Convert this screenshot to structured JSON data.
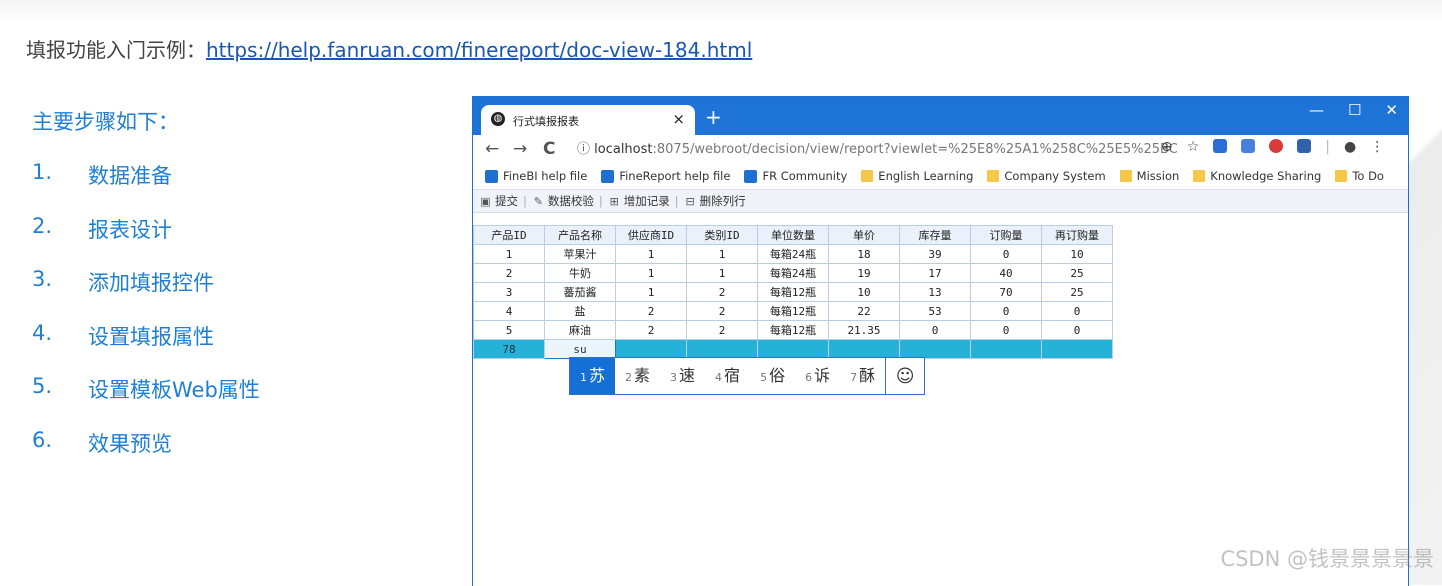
{
  "slide": {
    "intro_label": "填报功能入门示例：",
    "intro_link": "https://help.fanruan.com/finereport/doc-view-184.html",
    "steps_title": "主要步骤如下：",
    "steps": [
      {
        "num": "1.",
        "text": "数据准备"
      },
      {
        "num": "2.",
        "text": "报表设计"
      },
      {
        "num": "3.",
        "text": "添加填报控件"
      },
      {
        "num": "4.",
        "text": "设置填报属性"
      },
      {
        "num": "5.",
        "text": "设置模板Web属性"
      },
      {
        "num": "6.",
        "text": "效果预览"
      }
    ],
    "watermark": "CSDN @钱景景景景景"
  },
  "browser": {
    "tab_title": "行式填报报表",
    "tab_close": "×",
    "new_tab": "+",
    "window_buttons": {
      "minimize": "—",
      "maximize": "☐",
      "close": "✕"
    },
    "nav": {
      "back": "←",
      "forward": "→",
      "reload": "C"
    },
    "address": {
      "host": "localhost",
      "rest": ":8075/webroot/decision/view/report?viewlet=%25E8%25A1%258C%25E5%25BC..."
    },
    "bookmarks": [
      {
        "label": "FineBI help file",
        "icon": "finebi-icon"
      },
      {
        "label": "FineReport help file",
        "icon": "finereport-icon"
      },
      {
        "label": "FR Community",
        "icon": "finereport-icon"
      },
      {
        "label": "English Learning",
        "icon": "folder-icon"
      },
      {
        "label": "Company System",
        "icon": "folder-icon"
      },
      {
        "label": "Mission",
        "icon": "folder-icon"
      },
      {
        "label": "Knowledge Sharing",
        "icon": "folder-icon"
      },
      {
        "label": "To Do",
        "icon": "folder-icon"
      }
    ]
  },
  "report": {
    "toolbar": [
      {
        "label": "提交",
        "icon": "save-icon"
      },
      {
        "label": "数据校验",
        "icon": "verify-icon"
      },
      {
        "label": "增加记录",
        "icon": "add-row-icon"
      },
      {
        "label": "删除列行",
        "icon": "delete-row-icon"
      }
    ],
    "columns": [
      "产品ID",
      "产品名称",
      "供应商ID",
      "类别ID",
      "单位数量",
      "单价",
      "库存量",
      "订购量",
      "再订购量"
    ],
    "rows": [
      [
        "1",
        "苹果汁",
        "1",
        "1",
        "每箱24瓶",
        "18",
        "39",
        "0",
        "10"
      ],
      [
        "2",
        "牛奶",
        "1",
        "1",
        "每箱24瓶",
        "19",
        "17",
        "40",
        "25"
      ],
      [
        "3",
        "蕃茄酱",
        "1",
        "2",
        "每箱12瓶",
        "10",
        "13",
        "70",
        "25"
      ],
      [
        "4",
        "盐",
        "2",
        "2",
        "每箱12瓶",
        "22",
        "53",
        "0",
        "0"
      ],
      [
        "5",
        "麻油",
        "2",
        "2",
        "每箱12瓶",
        "21.35",
        "0",
        "0",
        "0"
      ]
    ],
    "new_row": [
      "78",
      "su",
      "",
      "",
      "",
      "",
      "",
      "",
      ""
    ]
  },
  "ime": {
    "candidates": [
      {
        "n": "1",
        "c": "苏"
      },
      {
        "n": "2",
        "c": "素"
      },
      {
        "n": "3",
        "c": "速"
      },
      {
        "n": "4",
        "c": "宿"
      },
      {
        "n": "5",
        "c": "俗"
      },
      {
        "n": "6",
        "c": "诉"
      },
      {
        "n": "7",
        "c": "酥"
      }
    ],
    "emoji": "☺"
  }
}
